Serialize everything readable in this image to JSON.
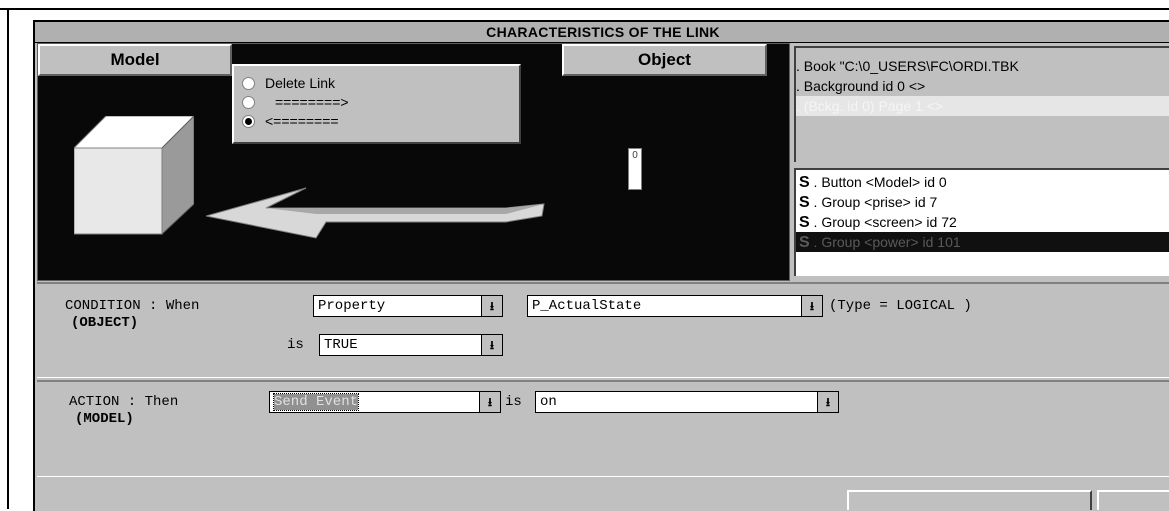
{
  "window": {
    "title": "CHARACTERISTICS OF THE LINK"
  },
  "header": {
    "model_label": "Model",
    "object_label": "Object"
  },
  "link_options": [
    {
      "label": "Delete Link",
      "checked": false
    },
    {
      "label": "========>",
      "checked": false
    },
    {
      "label": "<========",
      "checked": true
    }
  ],
  "object_marker": "0",
  "tree": [
    {
      "text": ".   Book \"C:\\0_USERS\\FC\\ORDI.TBK",
      "selected": false
    },
    {
      "text": ".     Background id 0 <>",
      "selected": false
    },
    {
      "text": ".       (Bckg. id 0) Page 1 <>",
      "selected": true
    }
  ],
  "items": [
    {
      "prefix": "S",
      "text": " .  Button <Model> id 0",
      "selected": false
    },
    {
      "prefix": "S",
      "text": " .  Group <prise> id 7",
      "selected": false
    },
    {
      "prefix": "S",
      "text": " .  Group <screen> id 72",
      "selected": false
    },
    {
      "prefix": "S",
      "text": " .  Group <power> id 101",
      "selected": true
    }
  ],
  "condition": {
    "label": "CONDITION : When",
    "sublabel": "(OBJECT)",
    "is_label": "is",
    "type_select": "Property",
    "property_select": "P_ActualState",
    "type_text": "(Type = LOGICAL )",
    "value_select": "TRUE"
  },
  "action": {
    "label": "ACTION : Then",
    "sublabel": "(MODEL)",
    "is_label": "is",
    "action_select": "Send Event",
    "event_select": "on"
  },
  "icons": {
    "dropdown_arrow": "⭳"
  }
}
